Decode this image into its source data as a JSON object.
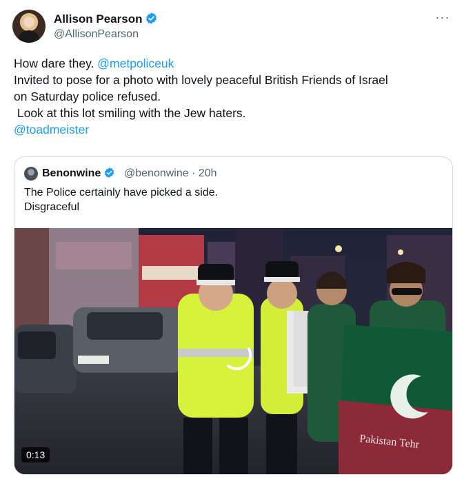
{
  "tweet": {
    "author_name": "Allison Pearson",
    "author_handle": "@AllisonPearson",
    "more_label": "···",
    "body": {
      "line1_prefix": "How dare they. ",
      "line1_mention": "@metpoliceuk",
      "line2": "Invited to pose for a photo with lovely peaceful British Friends of Israel",
      "line3": "on Saturday police refused.",
      "line4": " Look at this lot smiling with the Jew haters.",
      "line5_mention": "@toadmeister"
    }
  },
  "quote": {
    "author_name": "Benonwine",
    "handle_time": "@benonwine · 20h",
    "text_line1": "The Police certainly have picked a side.",
    "text_line2": "Disgraceful",
    "video_duration": "0:13",
    "flag_text": "Pakistan Tehr"
  },
  "colors": {
    "link": "#1d9bf0",
    "verified": "#1d9bf0",
    "text_primary": "#0f1419",
    "text_secondary": "#536471",
    "hi_vis": "#d6f23a",
    "flag_green": "#0f5a35",
    "flag_maroon": "#8c2a3a"
  }
}
